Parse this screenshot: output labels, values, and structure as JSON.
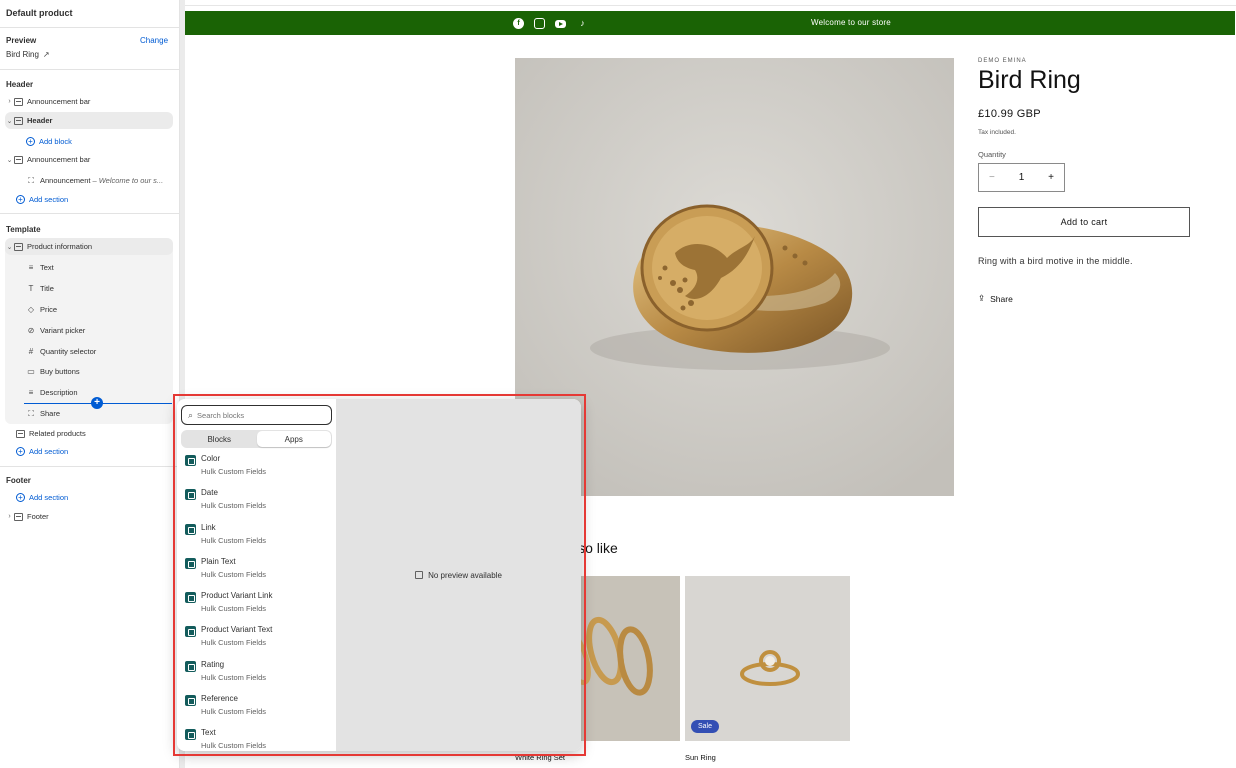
{
  "sidebar": {
    "title": "Default product",
    "preview_label": "Preview",
    "change_label": "Change",
    "preview_value": "Bird Ring",
    "header_group": "Header",
    "header_items": [
      {
        "label": "Announcement bar"
      },
      {
        "label": "Header"
      },
      {
        "label": "Add block"
      },
      {
        "label": "Announcement bar"
      },
      {
        "label": "Announcement",
        "detail": "– Welcome to our s..."
      },
      {
        "label": "Add section"
      }
    ],
    "template_group": "Template",
    "template_section": "Product information",
    "template_blocks": [
      "Text",
      "Title",
      "Price",
      "Variant picker",
      "Quantity selector",
      "Buy buttons",
      "Description",
      "Share"
    ],
    "related_products": "Related products",
    "template_add_section": "Add section",
    "footer_group": "Footer",
    "footer_add_section": "Add section",
    "footer_item": "Footer"
  },
  "preview": {
    "announcement": "Welcome to our store",
    "social_icons": [
      "facebook-icon",
      "instagram-icon",
      "youtube-icon",
      "tiktok-icon"
    ],
    "vendor": "DEMO EMINA",
    "title": "Bird Ring",
    "price": "£10.99 GBP",
    "tax": "Tax included.",
    "quantity_label": "Quantity",
    "quantity_minus": "−",
    "quantity_value": "1",
    "quantity_plus": "+",
    "add_to_cart": "Add to cart",
    "description": "Ring with a bird motive in the middle.",
    "share": "Share",
    "also_like": "lso like",
    "cards": [
      {
        "name": "White Ring Set",
        "badge": ""
      },
      {
        "name": "Sun Ring",
        "badge": "Sale"
      }
    ],
    "accent_color": "#1a6305"
  },
  "picker": {
    "search_placeholder": "Search blocks",
    "tabs": [
      "Blocks",
      "Apps"
    ],
    "active_tab": "Apps",
    "items": [
      {
        "name": "Color",
        "source": "Hulk Custom Fields"
      },
      {
        "name": "Date",
        "source": "Hulk Custom Fields"
      },
      {
        "name": "Link",
        "source": "Hulk Custom Fields"
      },
      {
        "name": "Plain Text",
        "source": "Hulk Custom Fields"
      },
      {
        "name": "Product Variant Link",
        "source": "Hulk Custom Fields"
      },
      {
        "name": "Product Variant Text",
        "source": "Hulk Custom Fields"
      },
      {
        "name": "Rating",
        "source": "Hulk Custom Fields"
      },
      {
        "name": "Reference",
        "source": "Hulk Custom Fields"
      },
      {
        "name": "Text",
        "source": "Hulk Custom Fields"
      }
    ],
    "no_preview": "No preview available",
    "highlight_color": "#e53935"
  }
}
